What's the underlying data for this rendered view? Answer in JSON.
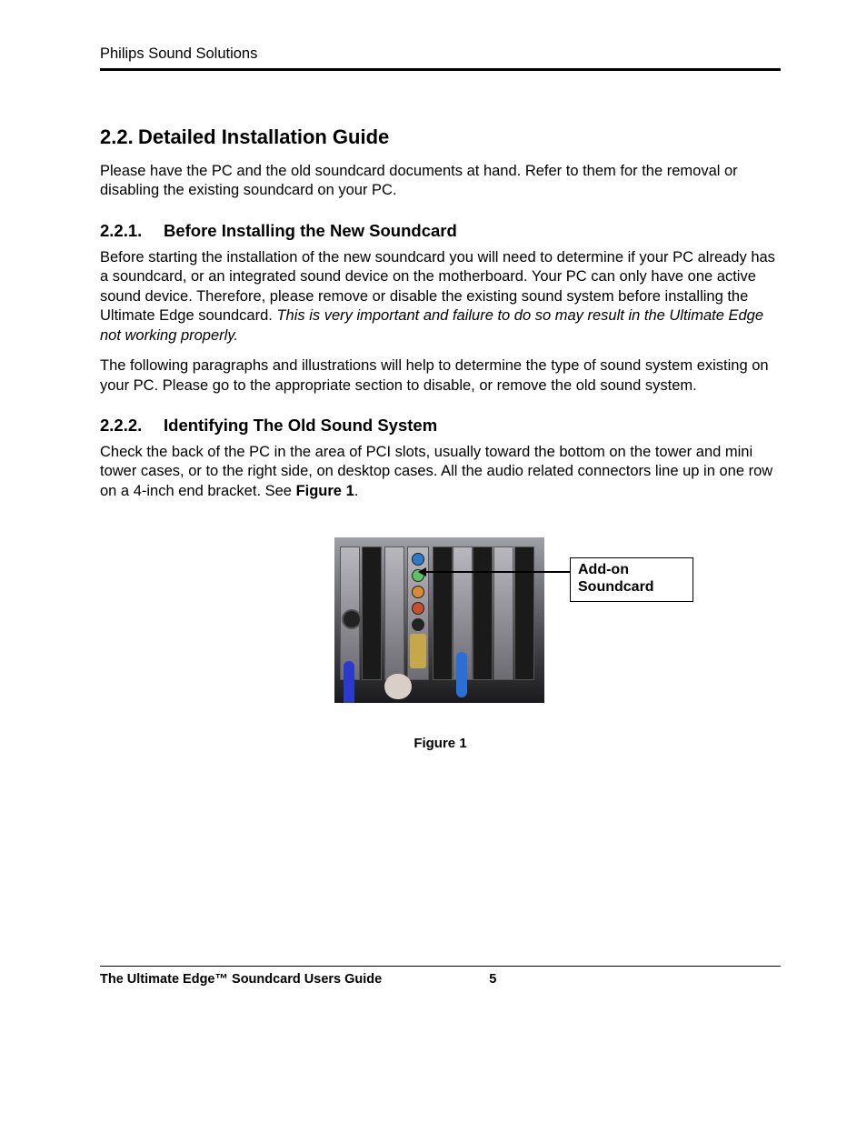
{
  "header": {
    "company": "Philips Sound Solutions"
  },
  "sections": {
    "s22": {
      "num": "2.2.",
      "title": "Detailed Installation Guide",
      "p1": "Please have the PC and the old soundcard documents at hand. Refer to them for the removal or disabling the existing soundcard on your PC."
    },
    "s221": {
      "num": "2.2.1.",
      "title": "Before Installing the New Soundcard",
      "p1a": "Before starting the installation of the new soundcard you will need to determine if your PC already has a soundcard, or an integrated sound device on the motherboard. Your PC can only have one active sound device. Therefore, please remove or disable the existing sound system before installing the Ultimate Edge soundcard. ",
      "p1b_italic": "This is very important and failure to do so may result in the Ultimate Edge not working properly.",
      "p2": "The following paragraphs and illustrations will help to determine the type of sound system existing on your PC. Please go to the appropriate section to disable, or remove the old sound system."
    },
    "s222": {
      "num": "2.2.2.",
      "title": "Identifying The Old Sound System",
      "p1a": "Check the back of the PC in the area of PCI slots, usually toward the bottom on the tower and mini tower cases, or to the right side, on desktop cases. All the audio related connectors line up in one row on a 4-inch end bracket. See ",
      "p1b_bold": "Figure 1",
      "p1c": "."
    }
  },
  "figure": {
    "callout": "Add-on Soundcard",
    "caption": "Figure 1"
  },
  "footer": {
    "title": "The Ultimate Edge™ Soundcard Users Guide",
    "page": "5"
  }
}
